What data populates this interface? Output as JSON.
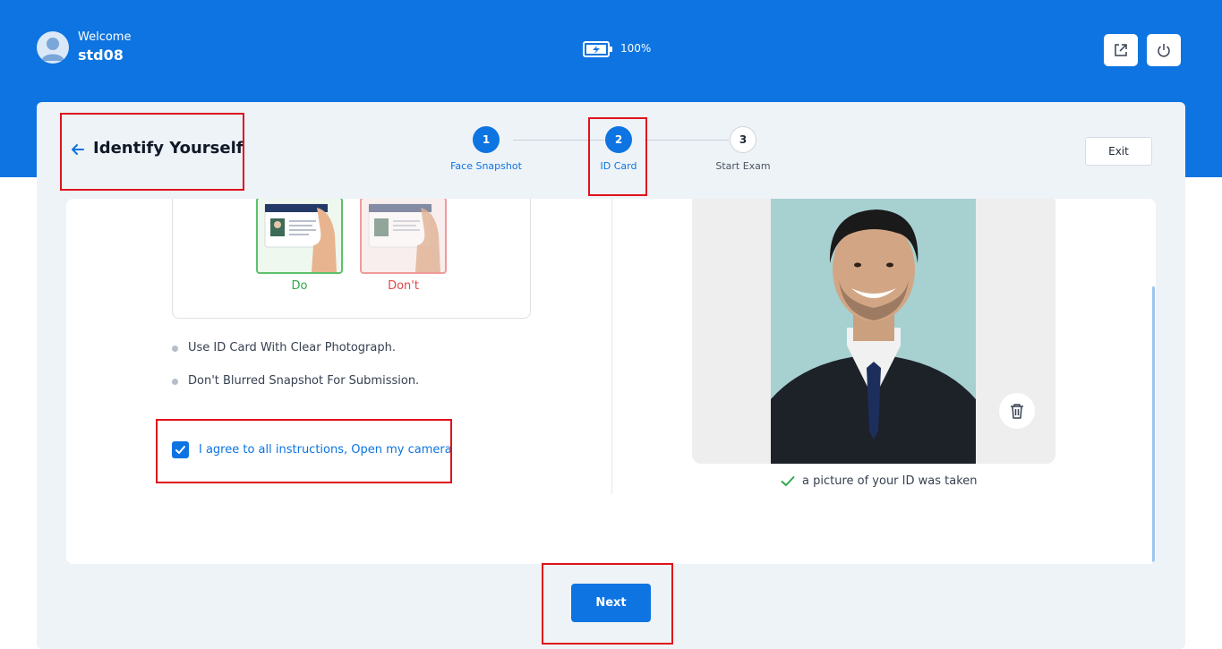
{
  "header": {
    "welcome": "Welcome",
    "username": "std08",
    "battery_level": "100%",
    "icons": [
      "user-avatar-icon",
      "battery-charging-icon",
      "external-link-icon",
      "power-icon"
    ]
  },
  "page": {
    "title": "Identify Yourself",
    "exit_label": "Exit"
  },
  "stepper": {
    "steps": [
      {
        "number": "1",
        "label": "Face Snapshot",
        "state": "done"
      },
      {
        "number": "2",
        "label": "ID Card",
        "state": "active"
      },
      {
        "number": "3",
        "label": "Start Exam",
        "state": "pending"
      }
    ]
  },
  "examples": {
    "do_label": "Do",
    "dont_label": "Don't"
  },
  "instructions": [
    "Use ID Card With Clear Photograph.",
    "Don't Blurred Snapshot For Submission."
  ],
  "agreement": {
    "label": "I agree to all instructions, Open my camera",
    "checked": true
  },
  "capture": {
    "status": "a picture of your ID was taken"
  },
  "footer": {
    "next_label": "Next"
  },
  "colors": {
    "primary": "#0d74e1",
    "success": "#2ea84a",
    "danger": "#e04848",
    "highlight": "#e0121b"
  }
}
